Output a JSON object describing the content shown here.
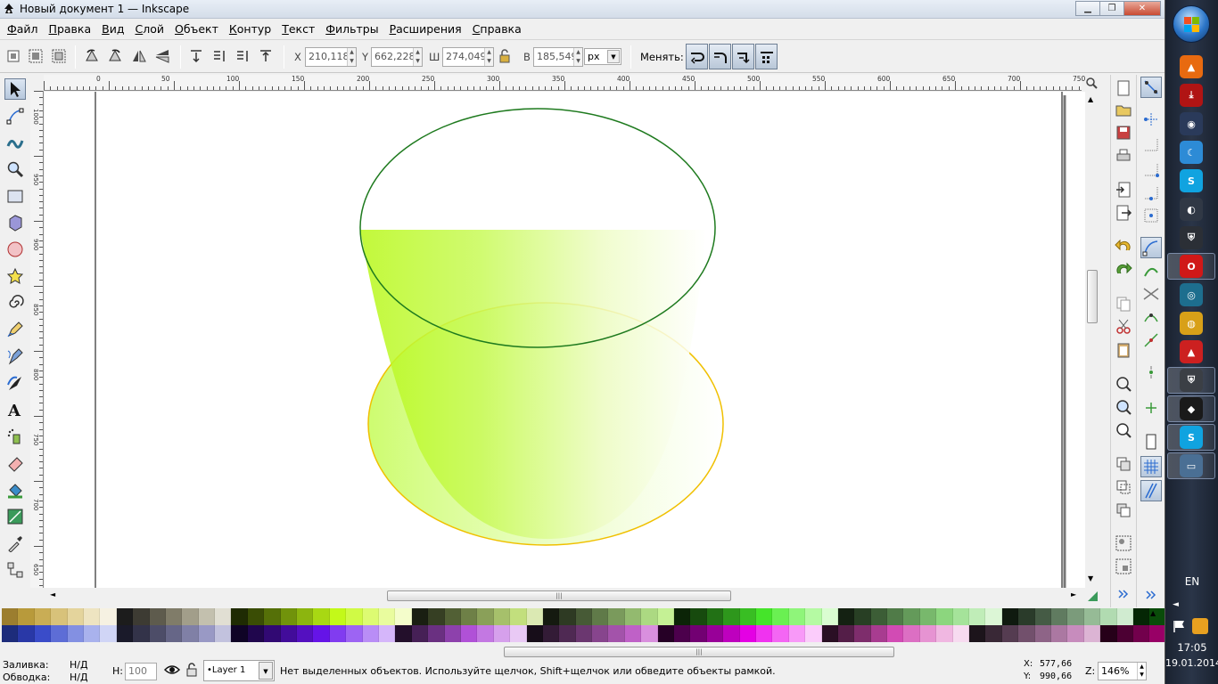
{
  "window": {
    "title": "Новый документ 1 — Inkscape",
    "min": "▁",
    "max": "❐",
    "close": "✕"
  },
  "menu": [
    {
      "label": "Файл",
      "accel": "Ф",
      "rest": "айл"
    },
    {
      "label": "Правка",
      "accel": "П",
      "rest": "равка"
    },
    {
      "label": "Вид",
      "accel": "В",
      "rest": "ид"
    },
    {
      "label": "Слой",
      "accel": "С",
      "rest": "лой"
    },
    {
      "label": "Объект",
      "accel": "О",
      "rest": "бъект"
    },
    {
      "label": "Контур",
      "accel": "К",
      "rest": "онтур"
    },
    {
      "label": "Текст",
      "accel": "Т",
      "rest": "екст"
    },
    {
      "label": "Фильтры",
      "accel": "Ф",
      "rest": "ильтры"
    },
    {
      "label": "Расширения",
      "accel": "Р",
      "rest": "асширения"
    },
    {
      "label": "Справка",
      "accel": "С",
      "rest": "правка"
    }
  ],
  "toolcontrols": {
    "x_label": "X",
    "x_value": "210,118",
    "y_label": "Y",
    "y_value": "662,228",
    "w_label": "Ш",
    "w_value": "274,049",
    "h_label": "В",
    "h_value": "185,549",
    "unit": "px",
    "transform_label": "Менять:"
  },
  "ruler": {
    "h_labels": [
      "0",
      "50",
      "100",
      "150",
      "200",
      "250",
      "300",
      "350",
      "400",
      "450",
      "500",
      "550",
      "600",
      "650",
      "700",
      "750"
    ],
    "v_labels": [
      "1000",
      "950",
      "900",
      "850",
      "800",
      "750",
      "700",
      "650"
    ]
  },
  "palette": {
    "top": [
      "#9c7e2f",
      "#b89a3b",
      "#c9ad55",
      "#d8c27a",
      "#e4d49c",
      "#eee4c1",
      "#f6f1e2",
      "#1c1c1c",
      "#3d3b33",
      "#5e5b4d",
      "#807c69",
      "#a29e8a",
      "#c3c0ae",
      "#e1dfd3",
      "#1f2b03",
      "#3a4d05",
      "#557008",
      "#71930b",
      "#8cb50f",
      "#a8d813",
      "#c3f919",
      "#d0fa45",
      "#ddfb72",
      "#e9fc9e",
      "#f4fdcb",
      "#1a1f12",
      "#363f23",
      "#526035",
      "#6e8047",
      "#8aa059",
      "#a6c06b",
      "#c2df7d",
      "#dbe9b3",
      "#151a10",
      "#2e3a23",
      "#475a36",
      "#607a49",
      "#7a9a5c",
      "#93ba6f",
      "#acd982",
      "#c5f195",
      "#0b2407",
      "#174a0e",
      "#227115",
      "#2e971c",
      "#39be23",
      "#45e42a",
      "#6af052",
      "#8ff57a",
      "#b5faa3",
      "#dafdd1",
      "#142112",
      "#283f24",
      "#3c5d36",
      "#507b48",
      "#649a5a",
      "#78b86c",
      "#8cd67e",
      "#a5e39a",
      "#c0edb8",
      "#dcf6d6",
      "#0f1a0f",
      "#2a3b2a",
      "#455b45",
      "#607b60",
      "#7b9b7b",
      "#96bb96",
      "#b1dbb1",
      "#d0ebd0",
      "#052605",
      "#0a4c0a",
      "#0f720f",
      "#149814",
      "#19be19",
      "#1ee41e",
      "#4cf04c",
      "#7af47a"
    ],
    "bottom": [
      "#1d2c7b",
      "#2938a7",
      "#3a4cc9",
      "#5d6dd6",
      "#8390e2",
      "#a9b2ed",
      "#d0d5f6",
      "#1a1a2a",
      "#333349",
      "#4d4d68",
      "#666687",
      "#8080a6",
      "#9999c5",
      "#c2c2de",
      "#0f0326",
      "#20064d",
      "#310973",
      "#420c9a",
      "#5410c0",
      "#6514e7",
      "#813cf0",
      "#9d64f3",
      "#b98df6",
      "#d5b6fa",
      "#230f2b",
      "#462056",
      "#6a3081",
      "#8d41ac",
      "#b051d7",
      "#c378e2",
      "#d6a0ec",
      "#e9c9f5",
      "#170d19",
      "#331b36",
      "#4f2953",
      "#6b3770",
      "#87458d",
      "#a353aa",
      "#bf61c7",
      "#d98fde",
      "#260026",
      "#4c004c",
      "#720072",
      "#980098",
      "#be00be",
      "#e400e4",
      "#f033f0",
      "#f466f4",
      "#f899f8",
      "#fbccfb",
      "#2a0f24",
      "#541e48",
      "#7e2d6c",
      "#a83c90",
      "#d24bb4",
      "#dc6fc3",
      "#e693d2",
      "#f0b7e1",
      "#f7dbf0",
      "#1c141b",
      "#392836",
      "#553c51",
      "#72506c",
      "#8e6487",
      "#ab78a2",
      "#c78cbd",
      "#dcb4d4",
      "#260019",
      "#4c0033",
      "#72004c",
      "#980066",
      "#be007f",
      "#e40099",
      "#f033b3",
      "#f466c6"
    ]
  },
  "status": {
    "fill_label": "Заливка:",
    "fill_value": "Н/Д",
    "stroke_label": "Обводка:",
    "stroke_value": "Н/Д",
    "opacity_label": "Н:",
    "opacity_value": "100",
    "layer": "•Layer 1",
    "message": "Нет выделенных объектов. Используйте щелчок, Shift+щелчок или обведите объекты рамкой.",
    "cx_label": "X:",
    "cx_value": "577,66",
    "cy_label": "Y:",
    "cy_value": "990,66",
    "zoom_label": "Z:",
    "zoom_value": "146%"
  },
  "taskbar": {
    "lang": "EN",
    "time": "17:05",
    "date": "19.01.2014",
    "apps": [
      {
        "name": "vlc-icon",
        "glyph": "▲",
        "color": "#e86a10"
      },
      {
        "name": "download-icon",
        "glyph": "⤓",
        "color": "#b01414"
      },
      {
        "name": "steam-icon",
        "glyph": "◉",
        "color": "#2a3a5a"
      },
      {
        "name": "crescent-icon",
        "glyph": "☾",
        "color": "#2d8bd6"
      },
      {
        "name": "skype-icon",
        "glyph": "S",
        "color": "#10a3e0"
      },
      {
        "name": "media-icon",
        "glyph": "◐",
        "color": "#303845"
      },
      {
        "name": "shield-icon",
        "glyph": "⛨",
        "color": "#2b2f36"
      },
      {
        "name": "opera-icon",
        "glyph": "O",
        "color": "#d01818"
      },
      {
        "name": "swirl-icon",
        "glyph": "◎",
        "color": "#1d6e8e"
      },
      {
        "name": "chrome-icon",
        "glyph": "◍",
        "color": "#d8a018"
      },
      {
        "name": "warning-icon",
        "glyph": "▲",
        "color": "#cc2020"
      },
      {
        "name": "tanks-icon",
        "glyph": "⛨",
        "color": "#3b3f45"
      },
      {
        "name": "inkscape-icon",
        "glyph": "◆",
        "color": "#1a1a1a"
      },
      {
        "name": "skype2-icon",
        "glyph": "S",
        "color": "#10a3e0"
      },
      {
        "name": "monitor-icon",
        "glyph": "▭",
        "color": "#4a6f94"
      }
    ]
  }
}
